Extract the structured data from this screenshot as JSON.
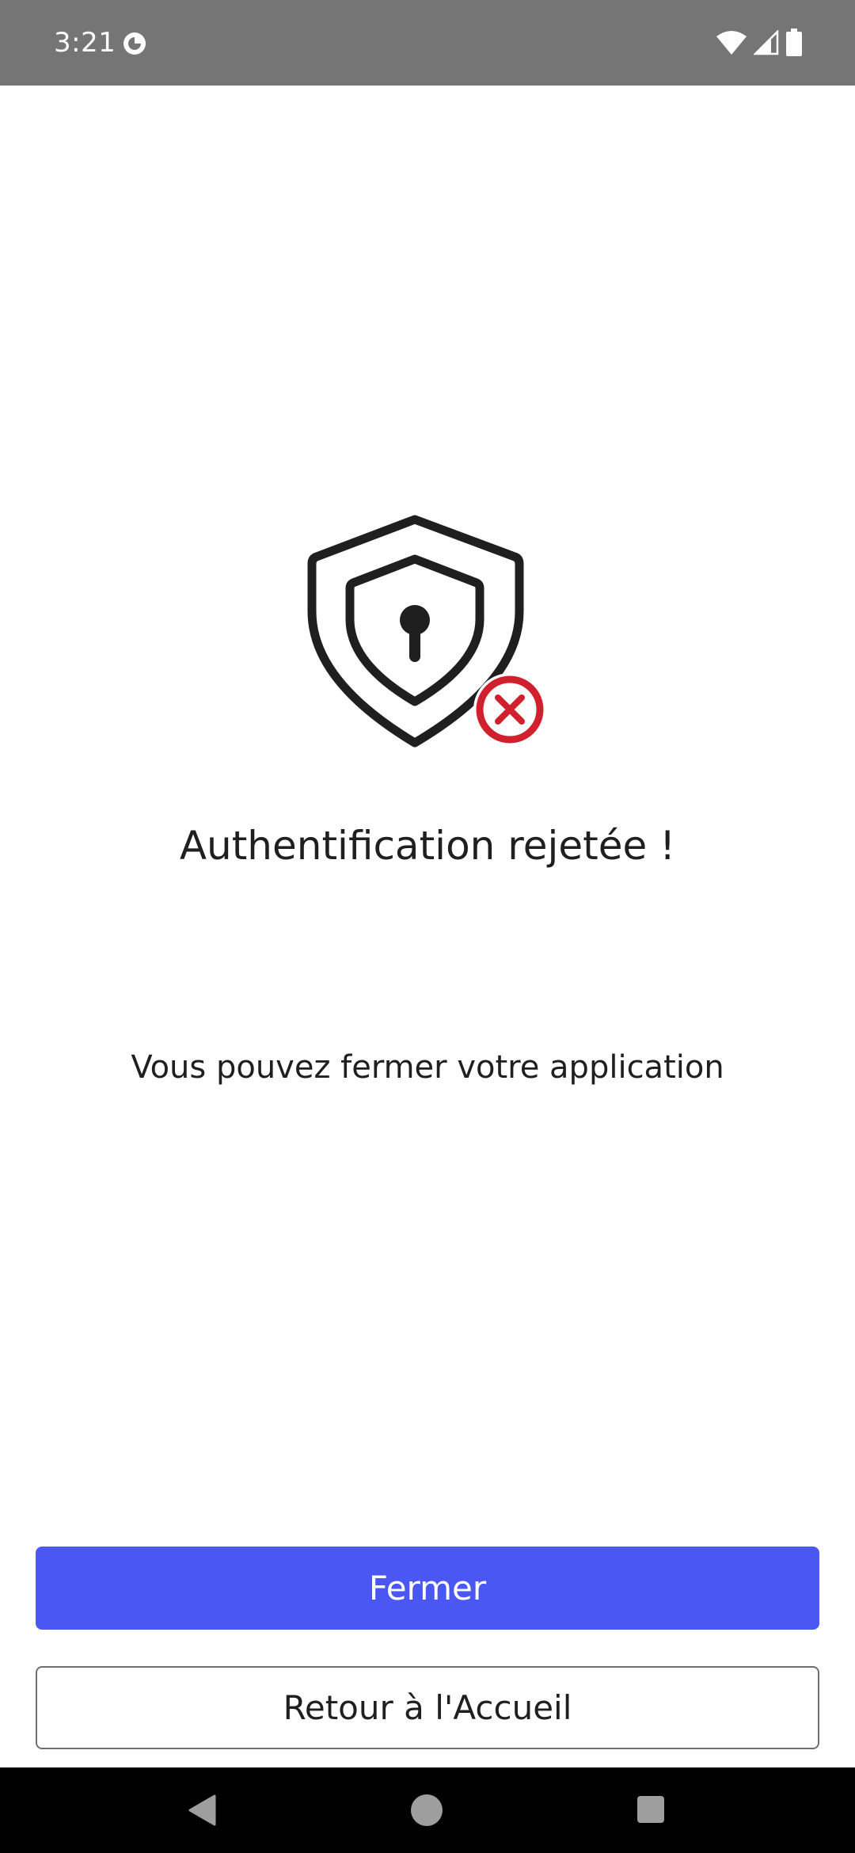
{
  "status_bar": {
    "time": "3:21",
    "icons": [
      "do-not-disturb-icon",
      "wifi-icon",
      "cell-signal-icon",
      "battery-icon"
    ],
    "background": "#757575"
  },
  "main": {
    "illustration": "shield-lock-rejected-icon",
    "title": "Authentification rejetée !",
    "subtitle": "Vous pouvez fermer votre application"
  },
  "actions": {
    "close_label": "Fermer",
    "home_label": "Retour à l'Accueil",
    "accent_color": "#4a57f2",
    "error_color": "#d0202e"
  },
  "nav_bar": {
    "icons": [
      "back-icon",
      "home-icon",
      "recents-icon"
    ]
  }
}
